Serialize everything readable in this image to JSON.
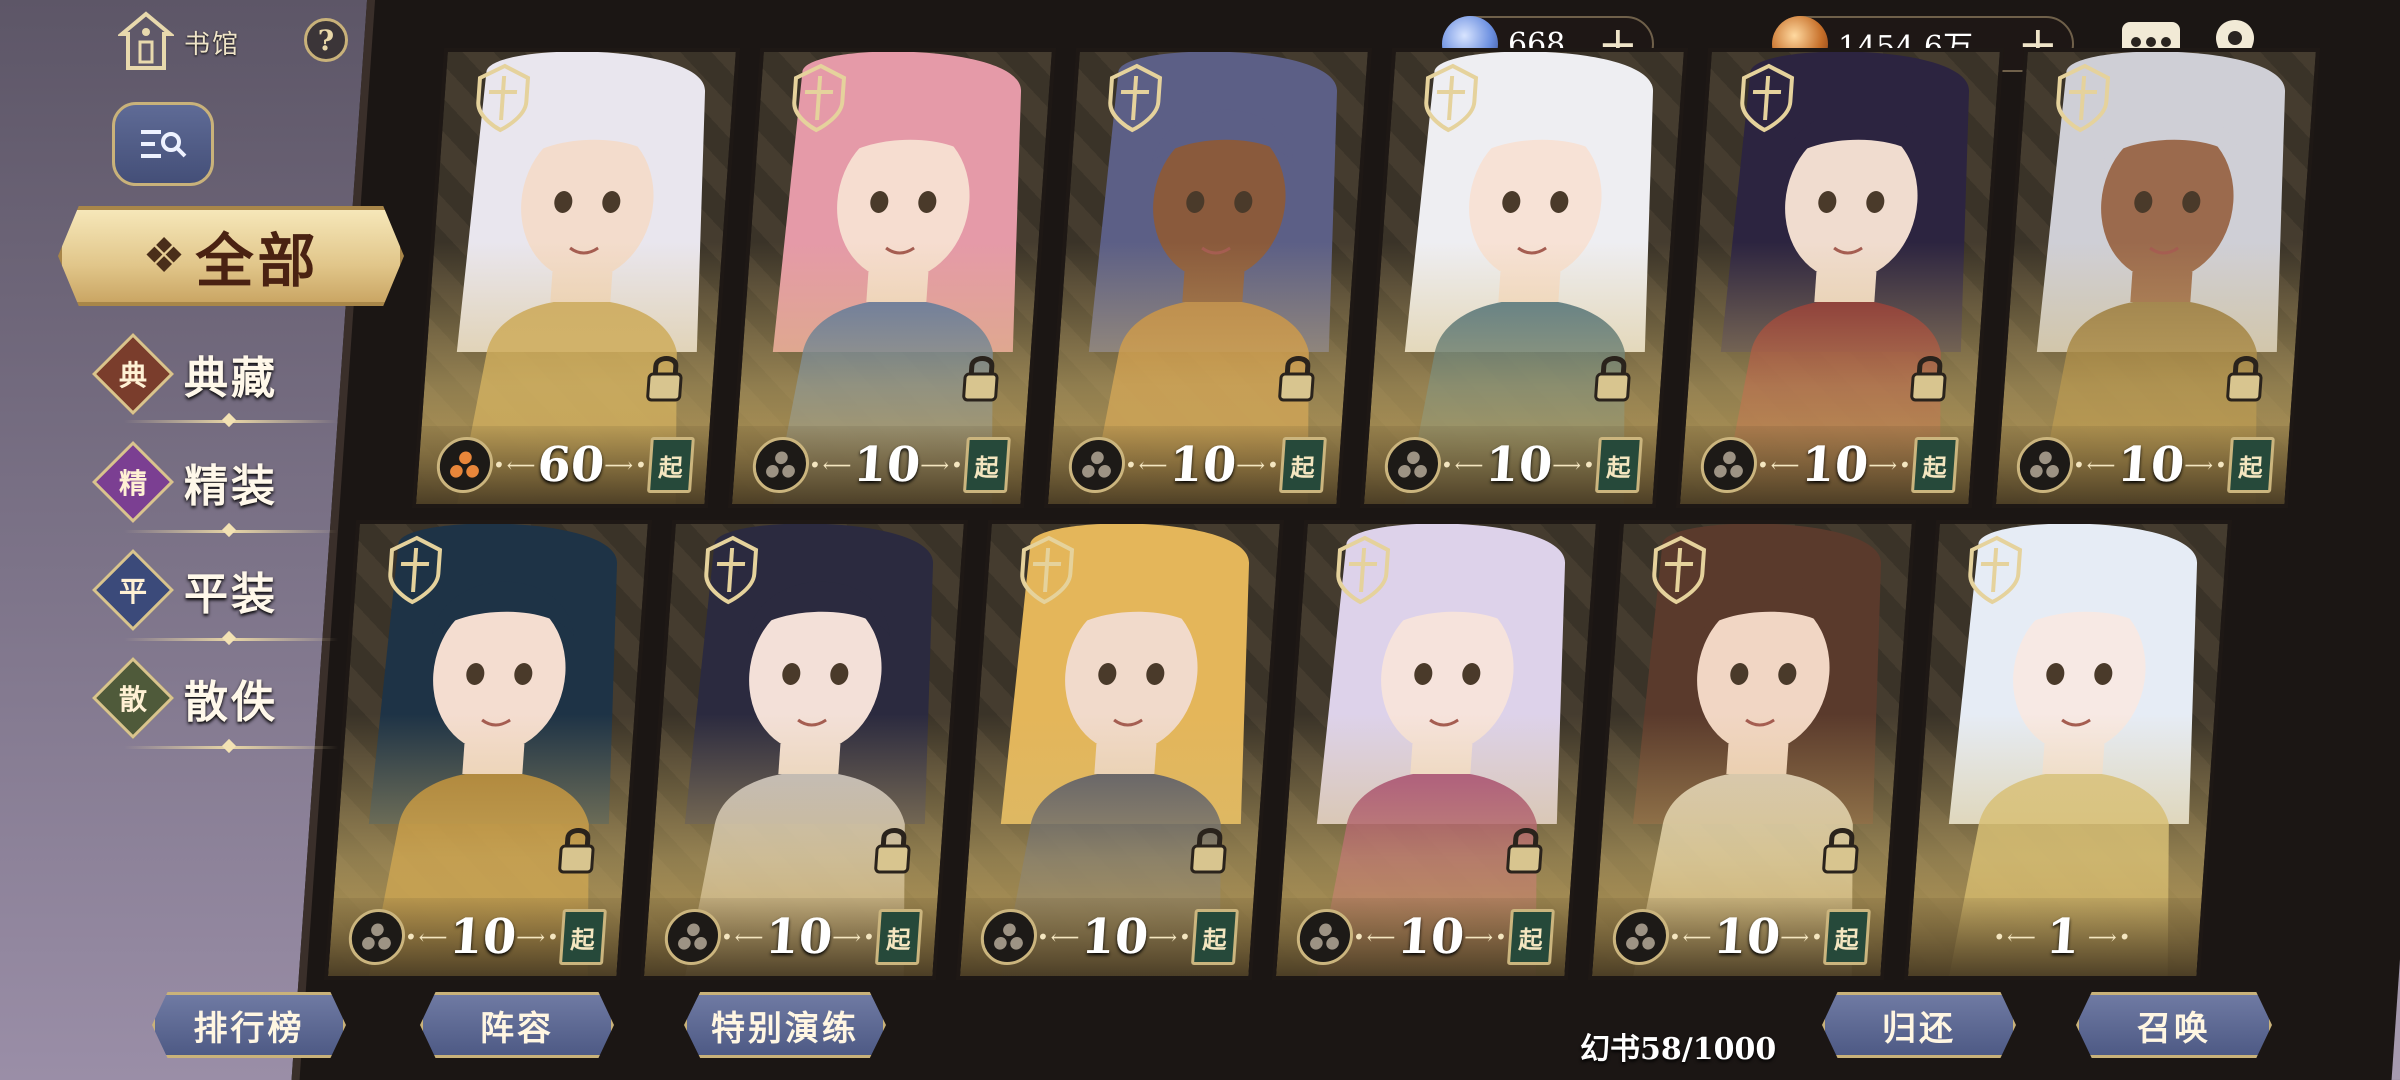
{
  "home": {
    "label": "书馆"
  },
  "help": {
    "label": "?"
  },
  "filter": {
    "all_label": "全部"
  },
  "categories": [
    {
      "badge": "典",
      "label": "典藏",
      "color": "#7a3d2c"
    },
    {
      "badge": "精",
      "label": "精装",
      "color": "#7b3f92"
    },
    {
      "badge": "平",
      "label": "平装",
      "color": "#3b4a7a"
    },
    {
      "badge": "散",
      "label": "散佚",
      "color": "#4f5a3a"
    }
  ],
  "currency": {
    "crystal": {
      "value": "668",
      "icon": "crystal-icon",
      "color": "#6b8fe0"
    },
    "coin": {
      "value": "1454.6万",
      "icon": "coin-icon",
      "color": "#c7702a"
    }
  },
  "top_icons": [
    "chat-icon",
    "location-icon"
  ],
  "cards_row1": [
    {
      "count": "60",
      "hair": "#e9e6ee",
      "skin": "#f3dccc",
      "accent": "#c9a24f",
      "token": "special"
    },
    {
      "count": "10",
      "hair": "#e59aa8",
      "skin": "#f6ddd0",
      "accent": "#3d67a8",
      "token": "normal"
    },
    {
      "count": "10",
      "hair": "#5c5f86",
      "skin": "#8a5a3c",
      "accent": "#c88a3a",
      "token": "normal"
    },
    {
      "count": "10",
      "hair": "#eeeef2",
      "skin": "#f7e2d6",
      "accent": "#2c5d7a",
      "token": "normal"
    },
    {
      "count": "10",
      "hair": "#2c2440",
      "skin": "#f0dccf",
      "accent": "#8a1e2a",
      "token": "normal"
    },
    {
      "count": "10",
      "hair": "#cfcfd6",
      "skin": "#9b6a4d",
      "accent": "#8b6a2e",
      "token": "normal"
    }
  ],
  "cards_row2": [
    {
      "count": "10",
      "hair": "#1e3346",
      "skin": "#f4ddd0",
      "accent": "#c08a2e",
      "token": "normal"
    },
    {
      "count": "10",
      "hair": "#2b2a3f",
      "skin": "#f3e0d8",
      "accent": "#d9d6e0",
      "token": "normal"
    },
    {
      "count": "10",
      "hair": "#e4b65a",
      "skin": "#f1dacb",
      "accent": "#2f3d6a",
      "token": "normal"
    },
    {
      "count": "10",
      "hair": "#ddd2ea",
      "skin": "#f6e3dc",
      "accent": "#9a2e6e",
      "token": "normal"
    },
    {
      "count": "10",
      "hair": "#5a3a2c",
      "skin": "#f1d6c4",
      "accent": "#efe8d8",
      "token": "normal"
    },
    {
      "count": "1",
      "hair": "#e6ecf5",
      "skin": "#f7e9e4",
      "accent": "#d8c37a",
      "token": "none"
    }
  ],
  "card_badge": "起",
  "bottom": {
    "ranking": "排行榜",
    "lineup": "阵容",
    "special_drill": "特别演练",
    "library_count": "幻书58/1000",
    "return": "归还",
    "summon": "召唤"
  }
}
